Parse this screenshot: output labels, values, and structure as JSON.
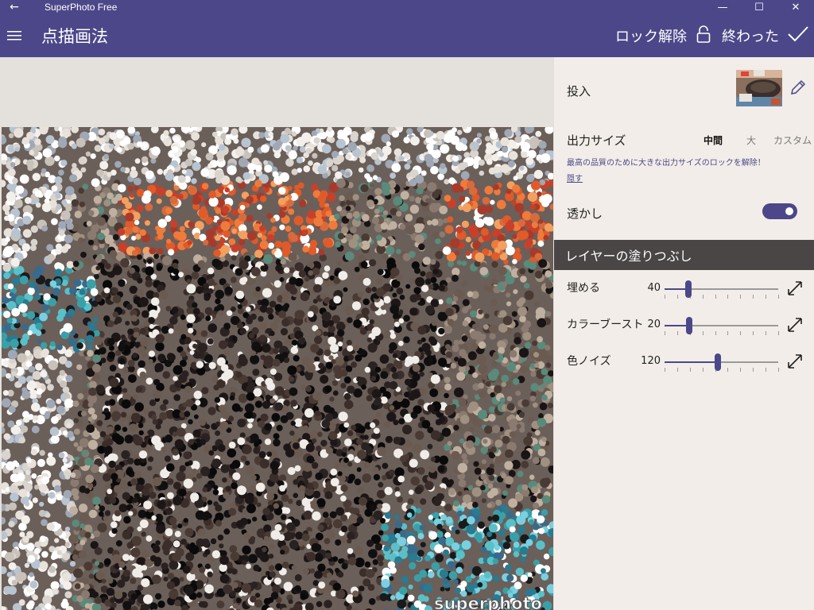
{
  "window": {
    "app_title": "SuperPhoto Free",
    "back_glyph": "←",
    "minimize_glyph": "—",
    "maximize_glyph": "☐",
    "close_glyph": "✕"
  },
  "appbar": {
    "page_title": "点描画法",
    "unlock_label": "ロック解除",
    "done_label": "終わった",
    "color": "#4c4788"
  },
  "canvas": {
    "watermark_text": "superphoto"
  },
  "panel": {
    "input_label": "投入",
    "output_size": {
      "label": "出力サイズ",
      "options": [
        "中間",
        "大",
        "カスタム"
      ],
      "selected": "中間",
      "upsell_text": "最高の品質のために大きな出力サイズのロックを解除！",
      "hide_link": "隠す"
    },
    "watermark": {
      "label": "透かし",
      "enabled": true
    },
    "layer_section_title": "レイヤーの塗りつぶし",
    "sliders": [
      {
        "label": "埋める",
        "value": "40",
        "position": 0.21
      },
      {
        "label": "カラーブースト",
        "value": "20",
        "position": 0.22
      },
      {
        "label": "色ノイズ",
        "value": "120",
        "position": 0.47
      }
    ]
  },
  "colors": {
    "accent": "#4c4788",
    "panel_bg": "#f2ede8",
    "section_header_bg": "#4a4646",
    "canvas_bg": "#e4e0db"
  },
  "icons": {
    "hamburger": "hamburger-menu-icon",
    "unlock": "padlock-icon",
    "done": "checkmark-icon",
    "edit": "pencil-icon",
    "expand": "expand-arrow-icon"
  }
}
